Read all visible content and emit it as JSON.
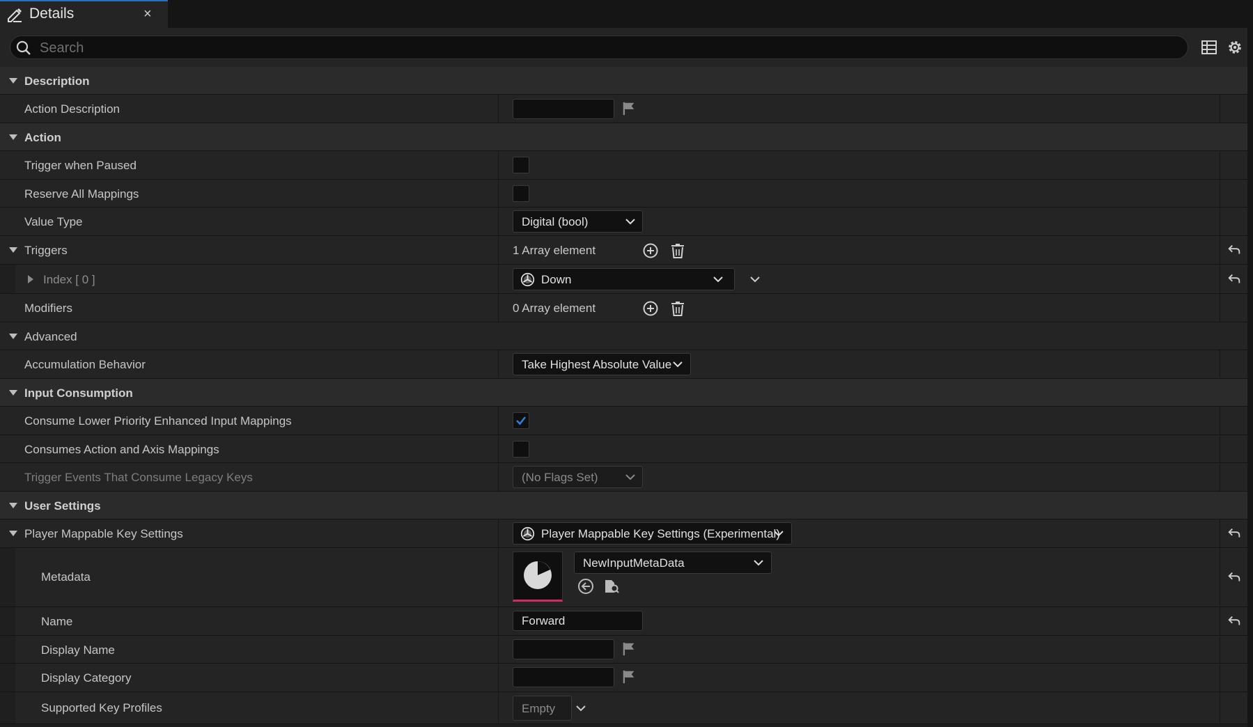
{
  "tab": {
    "title": "Details",
    "close": "×"
  },
  "search": {
    "placeholder": "Search"
  },
  "icons": {
    "tab": "pencil-icon",
    "search": "search-icon",
    "table": "table-view-icon",
    "settings": "gear-icon",
    "reset": "reset-arrow-icon",
    "flag": "localization-flag-icon",
    "add": "add-circle-icon",
    "delete": "trash-icon",
    "trigger": "input-trigger-icon",
    "browse": "browse-asset-icon",
    "use-selected": "use-selected-arrow-icon",
    "metadata": "data-asset-thumbnail-icon"
  },
  "colors": {
    "accent": "#2f6fb8",
    "checked": "#2d7fd6",
    "thumbnail_underline": "#d12c61"
  },
  "categories": {
    "description": "Description",
    "action": "Action",
    "advanced": "Advanced",
    "input_consumption": "Input Consumption",
    "user_settings": "User Settings"
  },
  "props": {
    "action_description": {
      "label": "Action Description",
      "value": ""
    },
    "trigger_when_paused": {
      "label": "Trigger when Paused",
      "checked": false
    },
    "reserve_all_mappings": {
      "label": "Reserve All Mappings",
      "checked": false
    },
    "value_type": {
      "label": "Value Type",
      "value": "Digital (bool)"
    },
    "triggers": {
      "label": "Triggers",
      "value": "1 Array element"
    },
    "trigger_index0": {
      "label": "Index [ 0 ]",
      "value": "Down"
    },
    "modifiers": {
      "label": "Modifiers",
      "value": "0 Array element"
    },
    "accumulation_behavior": {
      "label": "Accumulation Behavior",
      "value": "Take Highest Absolute Value"
    },
    "consume_lower_priority": {
      "label": "Consume Lower Priority Enhanced Input Mappings",
      "checked": true
    },
    "consumes_action_axis": {
      "label": "Consumes Action and Axis Mappings",
      "checked": false
    },
    "trigger_events_legacy": {
      "label": "Trigger Events That Consume Legacy Keys",
      "value": "(No Flags Set)"
    },
    "player_mappable": {
      "label": "Player Mappable Key Settings",
      "value": "Player Mappable Key Settings (Experimental)"
    },
    "metadata": {
      "label": "Metadata",
      "value": "NewInputMetaData"
    },
    "name": {
      "label": "Name",
      "value": "Forward"
    },
    "display_name": {
      "label": "Display Name",
      "value": ""
    },
    "display_category": {
      "label": "Display Category",
      "value": ""
    },
    "supported_key_profiles": {
      "label": "Supported Key Profiles",
      "value": "Empty"
    }
  }
}
